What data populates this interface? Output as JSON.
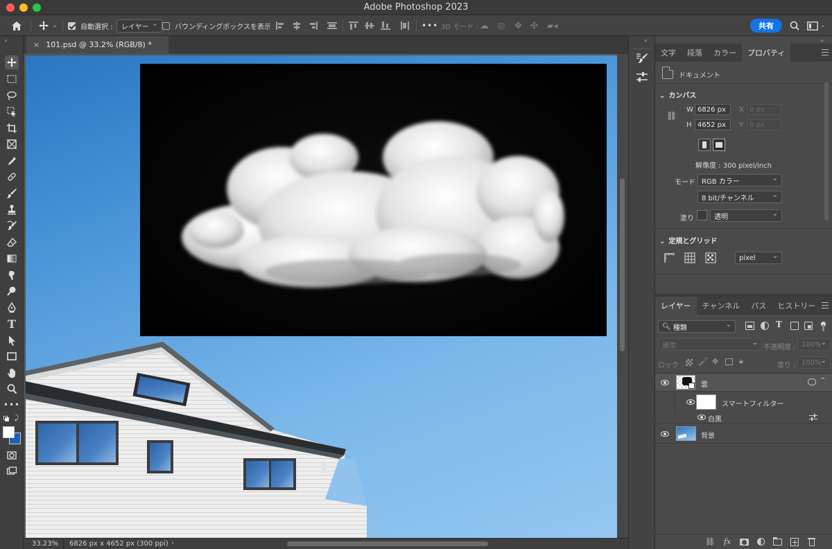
{
  "window": {
    "title": "Adobe Photoshop 2023"
  },
  "options_bar": {
    "auto_select_label": "自動選択 :",
    "auto_select_target": "レイヤー",
    "bounding_box_label": "バウンディングボックスを表示",
    "mode3d_label": "3D モード :",
    "more": "•••",
    "share_label": "共有"
  },
  "document": {
    "tab_title": "101.psd @ 33.2% (RGB/8) *",
    "zoom": "33.23%",
    "info": "6826 px x 4652 px (300 ppi)",
    "arrow": "›"
  },
  "properties_panel": {
    "tabs": [
      "文字",
      "段落",
      "カラー",
      "プロパティ"
    ],
    "active_tab": "プロパティ",
    "doc_label": "ドキュメント",
    "canvas_section": "カンバス",
    "w_label": "W",
    "w_value": "6826 px",
    "h_label": "H",
    "h_value": "4652 px",
    "x_label": "X",
    "x_placeholder": "0 px",
    "y_label": "Y",
    "y_placeholder": "0 px",
    "resolution": "解像度 : 300 pixel/inch",
    "mode_label": "モード",
    "mode_value": "RGB カラー",
    "bit_value": "8 bit/チャンネル",
    "fill_label": "塗り",
    "fill_value": "透明",
    "grid_section": "定規とグリッド",
    "unit_value": "pixel"
  },
  "layers_panel": {
    "tabs": [
      "レイヤー",
      "チャンネル",
      "パス",
      "ヒストリー"
    ],
    "active_tab": "レイヤー",
    "filter_kind": "種類",
    "blend_mode": "通常",
    "opacity_label": "不透明度 :",
    "opacity_value": "100%",
    "lock_label": "ロック :",
    "fill_label": "塗り :",
    "fill_value": "100%",
    "layers": [
      {
        "name": "雲"
      },
      {
        "name": "スマートフィルター"
      },
      {
        "name": "白黒"
      },
      {
        "name": "背景"
      }
    ]
  },
  "colors": {
    "accent": "#1473e6",
    "foreground": "#ffffff",
    "background": "#1e5fb5"
  }
}
